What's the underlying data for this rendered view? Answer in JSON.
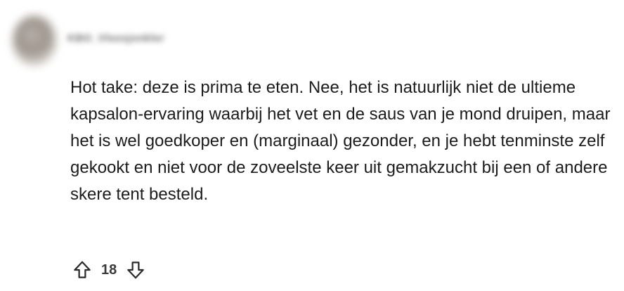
{
  "comment": {
    "username": "KBO_Vleesjonkler",
    "text": "Hot take: deze is prima te eten. Nee, het is natuurlijk niet de ultieme kapsalon-ervaring waarbij het vet en de saus van je mond druipen, maar het is wel goedkoper en (marginaal) gezonder, en je hebt tenminste zelf gekookt en niet voor de zoveelste keer uit gemakzucht bij een of andere skere tent besteld.",
    "score": "18"
  },
  "icons": {
    "upvote": "upvote-arrow-icon",
    "downvote": "downvote-arrow-icon",
    "avatar": "user-avatar"
  }
}
